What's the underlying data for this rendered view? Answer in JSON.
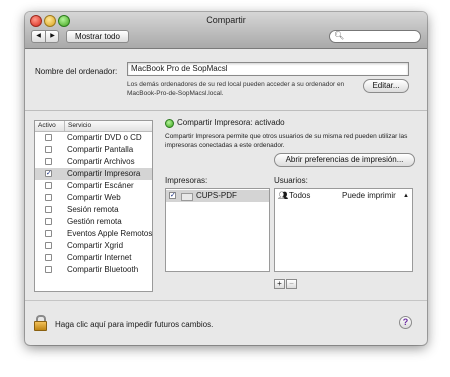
{
  "window": {
    "title": "Compartir"
  },
  "toolbar": {
    "back_label": "◀",
    "forward_label": "▶",
    "show_all_label": "Mostrar todo",
    "search_placeholder": ""
  },
  "computer_name": {
    "label": "Nombre del ordenador:",
    "value": "MacBook Pro de SopMacsl",
    "description": "Los demás ordenadores de su red local pueden acceder a su ordenador en MacBook-Pro-de-SopMacsl.local.",
    "edit_label": "Editar..."
  },
  "services": {
    "header_active": "Activo",
    "header_service": "Servicio",
    "items": [
      {
        "label": "Compartir DVD o CD",
        "checked": false
      },
      {
        "label": "Compartir Pantalla",
        "checked": false
      },
      {
        "label": "Compartir Archivos",
        "checked": false
      },
      {
        "label": "Compartir Impresora",
        "checked": true
      },
      {
        "label": "Compartir Escáner",
        "checked": false
      },
      {
        "label": "Compartir Web",
        "checked": false
      },
      {
        "label": "Sesión remota",
        "checked": false
      },
      {
        "label": "Gestión remota",
        "checked": false
      },
      {
        "label": "Eventos Apple Remotos",
        "checked": false
      },
      {
        "label": "Compartir Xgrid",
        "checked": false
      },
      {
        "label": "Compartir Internet",
        "checked": false
      },
      {
        "label": "Compartir Bluetooth",
        "checked": false
      }
    ],
    "selected_index": 3
  },
  "detail": {
    "status": "Compartir Impresora: activado",
    "description": "Compartir Impresora permite que otros usuarios de su misma red pueden utilizar las impresoras conectadas a este ordenador.",
    "open_prefs_label": "Abrir preferencias de impresión...",
    "printers_label": "Impresoras:",
    "users_label": "Usuarios:",
    "printers": [
      {
        "name": "CUPS-PDF",
        "checked": true
      }
    ],
    "users": [
      {
        "name": "Todos",
        "permission": "Puede imprimir"
      }
    ],
    "add_label": "+",
    "remove_label": "−"
  },
  "footer": {
    "lock_text": "Haga clic aquí para impedir futuros cambios.",
    "help_label": "?"
  },
  "colors": {
    "status_on": "#3aa21a",
    "selection": "#d4d4d4",
    "checkmark": "#1a2f80"
  }
}
